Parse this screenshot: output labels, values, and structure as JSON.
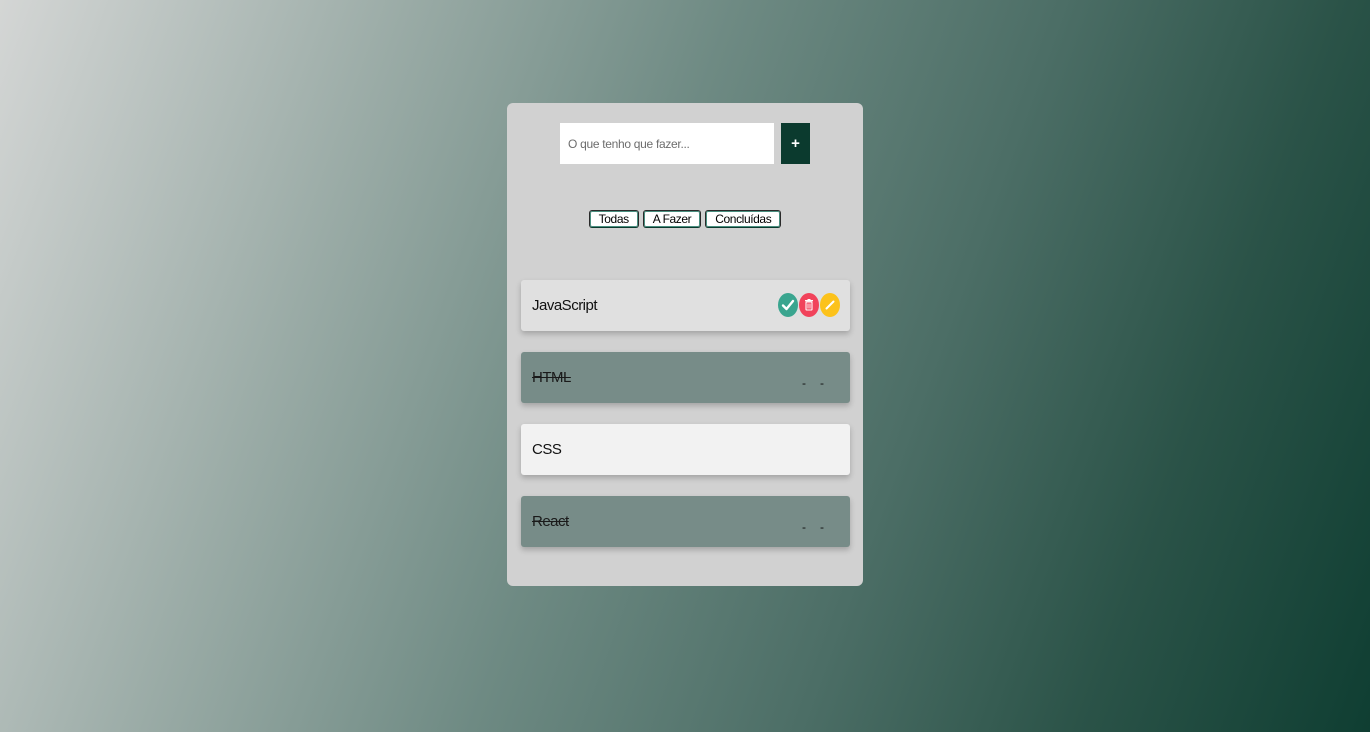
{
  "input": {
    "placeholder": "O que tenho que fazer...",
    "add_label": "+"
  },
  "filters": [
    "Todas",
    "A Fazer",
    "Concluídas"
  ],
  "tasks": [
    {
      "label": "JavaScript",
      "state": "selected"
    },
    {
      "label": "HTML",
      "state": "done",
      "actions": [
        "-",
        "-"
      ]
    },
    {
      "label": "CSS",
      "state": "pending"
    },
    {
      "label": "React",
      "state": "done",
      "actions": [
        "-",
        "-"
      ]
    }
  ],
  "icons": {
    "check": "check-circle-icon",
    "delete": "trash-icon",
    "edit": "pencil-icon"
  },
  "colors": {
    "accent": "#0b3a2e",
    "check": "#3aa58f",
    "delete": "#f1435b",
    "edit": "#fcc21b",
    "done_bg": "#778c88"
  }
}
